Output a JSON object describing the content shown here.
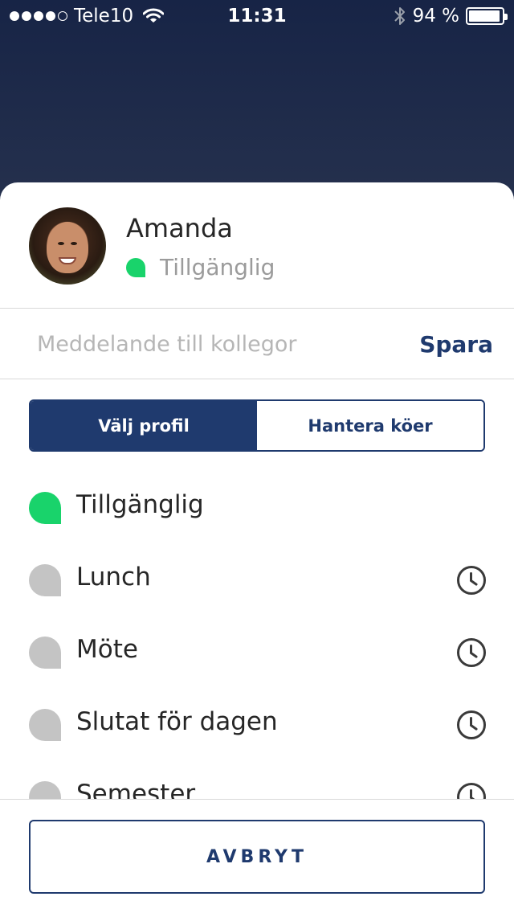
{
  "status_bar": {
    "carrier": "Tele10",
    "time": "11:31",
    "battery": "94 %",
    "battery_level": 0.94,
    "signal_bars": 4,
    "signal_max": 5,
    "icons": [
      "signal-dots-icon",
      "wifi-icon",
      "bluetooth-icon",
      "battery-icon"
    ]
  },
  "profile": {
    "name": "Amanda",
    "status": "Tillgänglig",
    "status_color": "#19d36b"
  },
  "message": {
    "placeholder": "Meddelande till kollegor",
    "value": "",
    "save_label": "Spara"
  },
  "tabs": [
    {
      "label": "Välj profil",
      "active": true
    },
    {
      "label": "Hantera köer",
      "active": false
    }
  ],
  "profiles": [
    {
      "label": "Tillgänglig",
      "color": "#19d36b",
      "has_clock": false
    },
    {
      "label": "Lunch",
      "color": "#c4c4c4",
      "has_clock": true
    },
    {
      "label": "Möte",
      "color": "#c4c4c4",
      "has_clock": true
    },
    {
      "label": "Slutat för dagen",
      "color": "#c4c4c4",
      "has_clock": true
    },
    {
      "label": "Semester",
      "color": "#c4c4c4",
      "has_clock": true
    }
  ],
  "footer": {
    "cancel_label": "AVBRYT"
  },
  "colors": {
    "accent": "#1f3a6e",
    "available": "#19d36b",
    "inactive": "#c4c4c4"
  }
}
